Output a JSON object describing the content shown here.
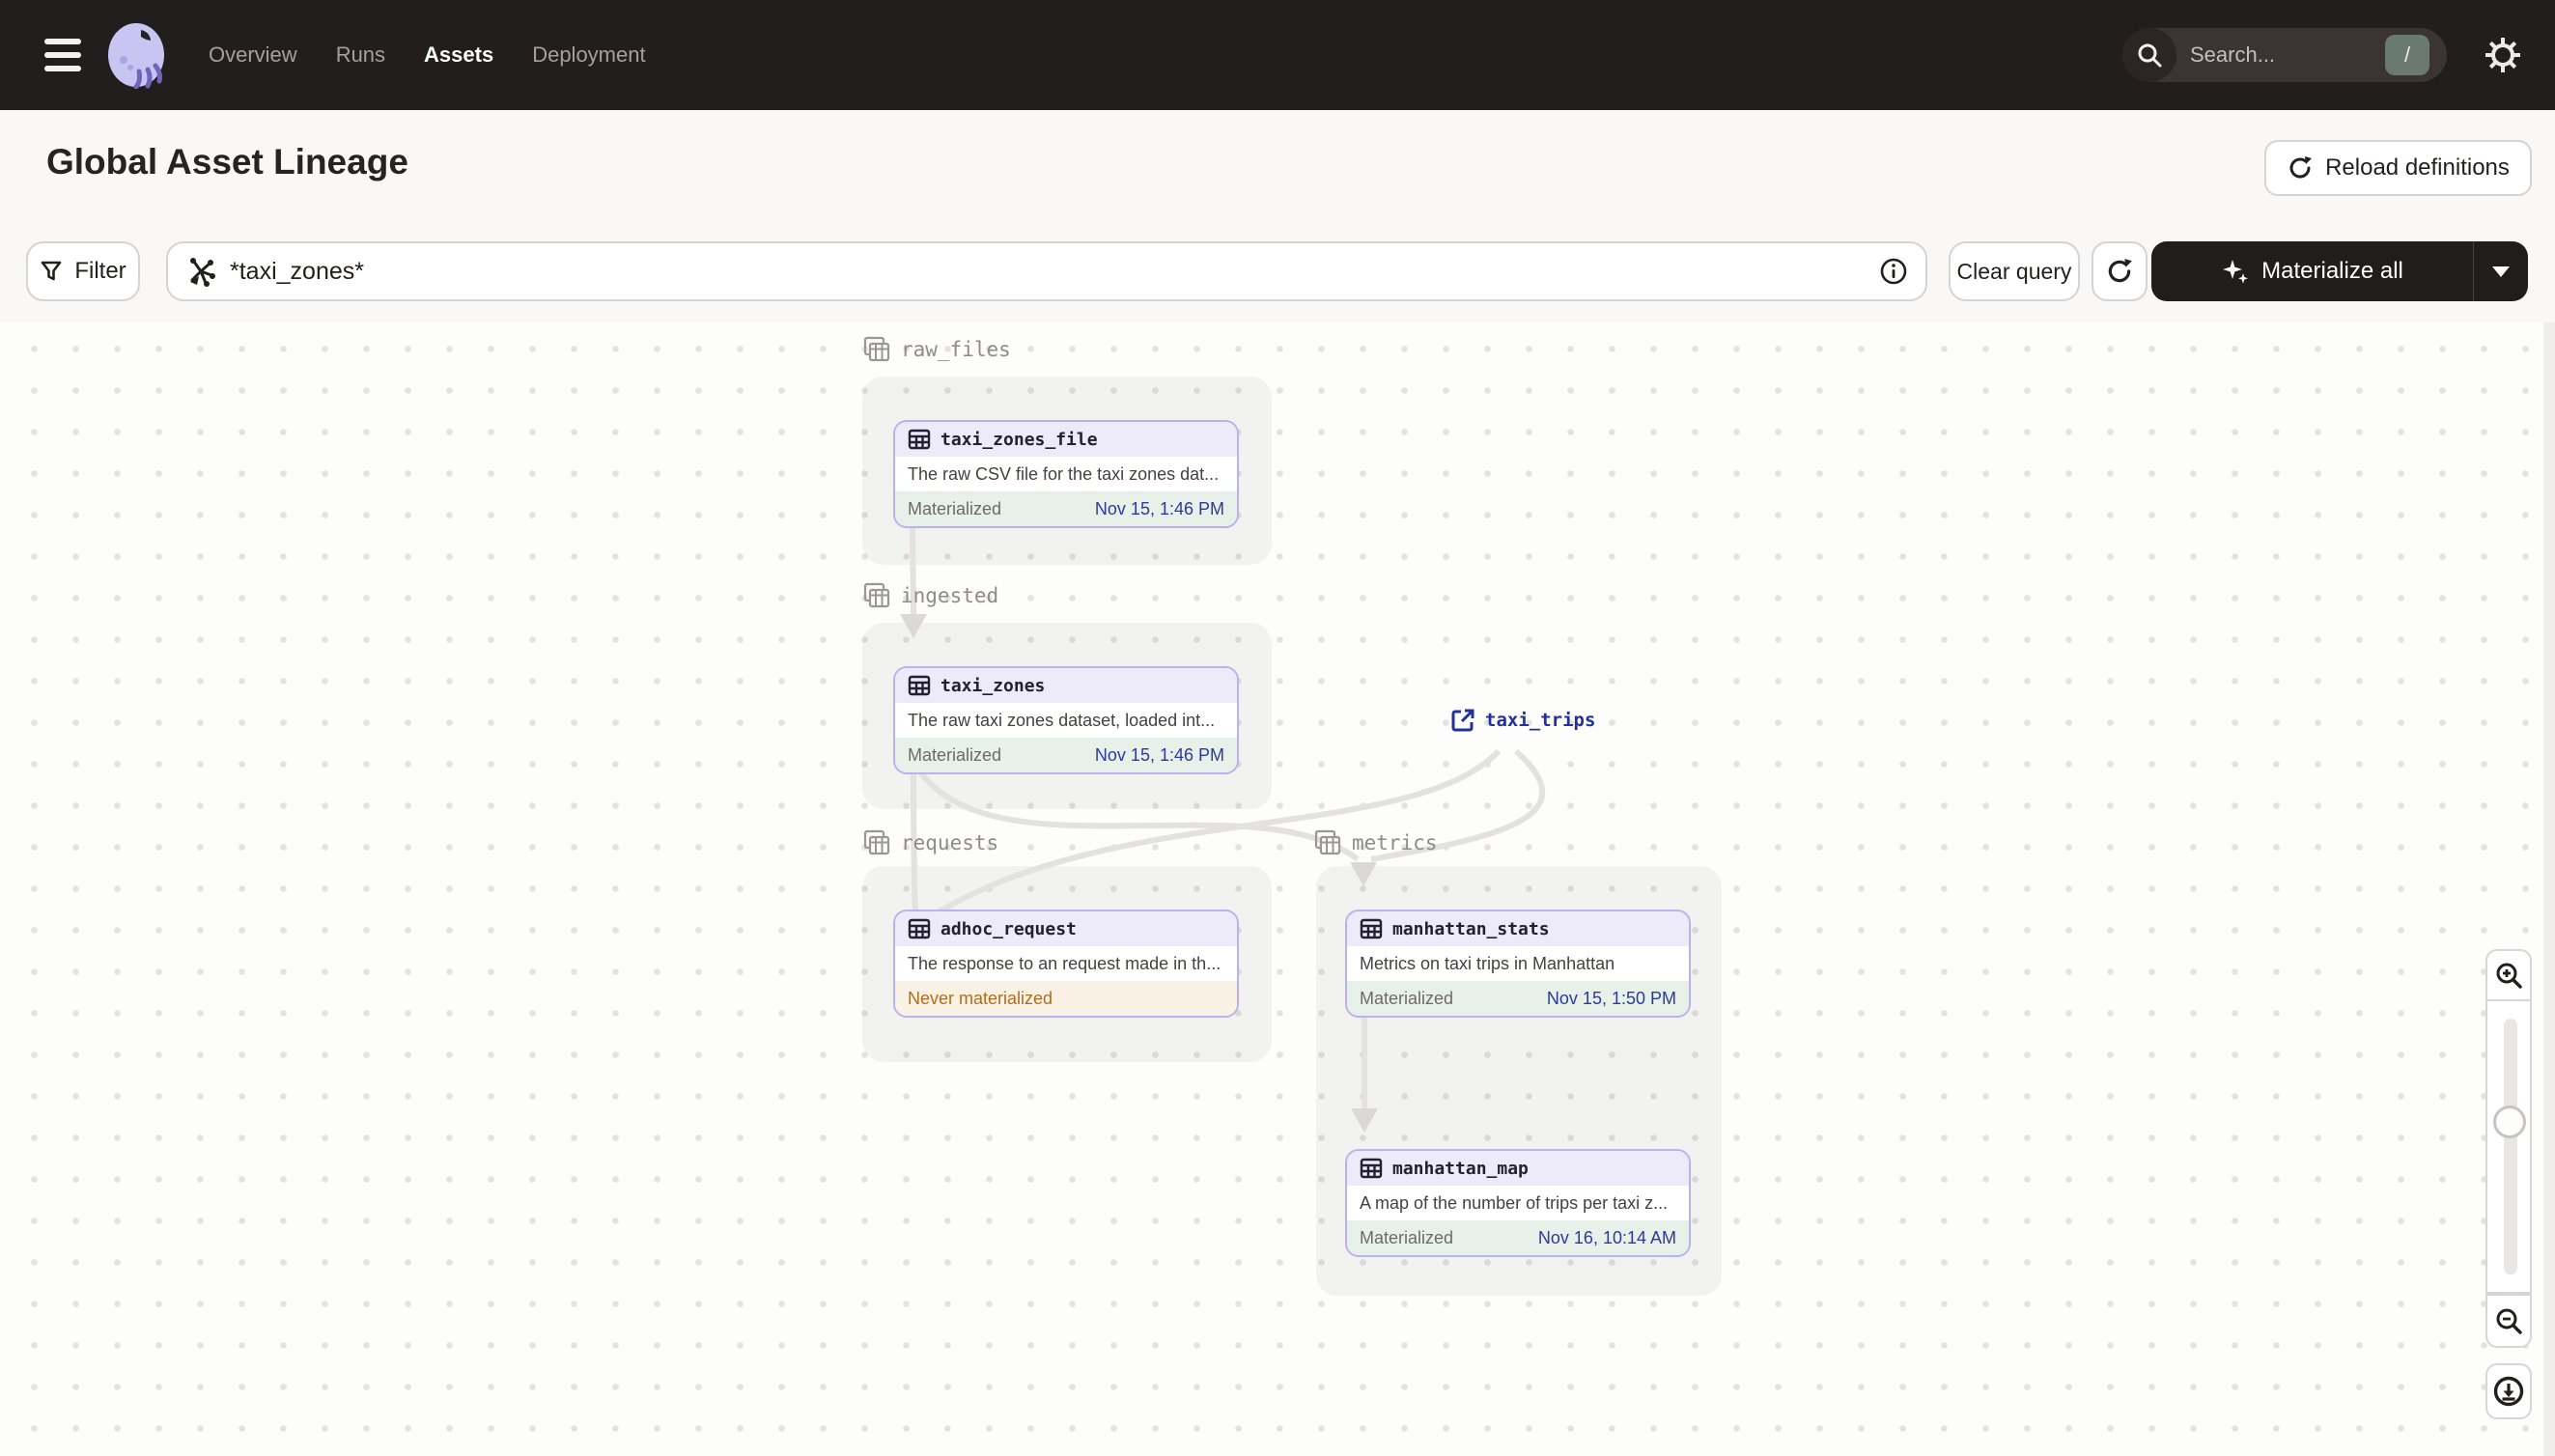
{
  "nav": {
    "items": [
      {
        "label": "Overview",
        "active": false
      },
      {
        "label": "Runs",
        "active": false
      },
      {
        "label": "Assets",
        "active": true
      },
      {
        "label": "Deployment",
        "active": false
      }
    ],
    "search_placeholder": "Search...",
    "search_shortcut": "/"
  },
  "header": {
    "title": "Global Asset Lineage",
    "reload_button": "Reload definitions"
  },
  "toolbar": {
    "filter_button": "Filter",
    "query_value": "*taxi_zones*",
    "clear_button": "Clear query",
    "materialize_button": "Materialize all"
  },
  "graph": {
    "groups": [
      {
        "name": "raw_files"
      },
      {
        "name": "ingested"
      },
      {
        "name": "requests"
      },
      {
        "name": "metrics"
      }
    ],
    "nodes": {
      "taxi_zones_file": {
        "name": "taxi_zones_file",
        "description": "The raw CSV file for the taxi zones dat...",
        "status": "Materialized",
        "time": "Nov 15, 1:46 PM"
      },
      "taxi_zones": {
        "name": "taxi_zones",
        "description": "The raw taxi zones dataset, loaded int...",
        "status": "Materialized",
        "time": "Nov 15, 1:46 PM"
      },
      "adhoc_request": {
        "name": "adhoc_request",
        "description": "The response to an request made in th...",
        "status": "Never materialized",
        "time": ""
      },
      "manhattan_stats": {
        "name": "manhattan_stats",
        "description": "Metrics on taxi trips in Manhattan",
        "status": "Materialized",
        "time": "Nov 15, 1:50 PM"
      },
      "manhattan_map": {
        "name": "manhattan_map",
        "description": "A map of the number of trips per taxi z...",
        "status": "Materialized",
        "time": "Nov 16, 10:14 AM"
      }
    },
    "external": {
      "name": "taxi_trips"
    }
  },
  "colors": {
    "nav_bg": "#221e1d",
    "accent_lavender": "#b9b2ee",
    "node_header_bg": "#edebfa",
    "materialized_bg": "#e8f0ea",
    "materialized_time": "#2b3a9e",
    "never_materialized_text": "#b06d1d",
    "never_materialized_bg": "#f8f1e4",
    "edge": "#e4e1df"
  }
}
